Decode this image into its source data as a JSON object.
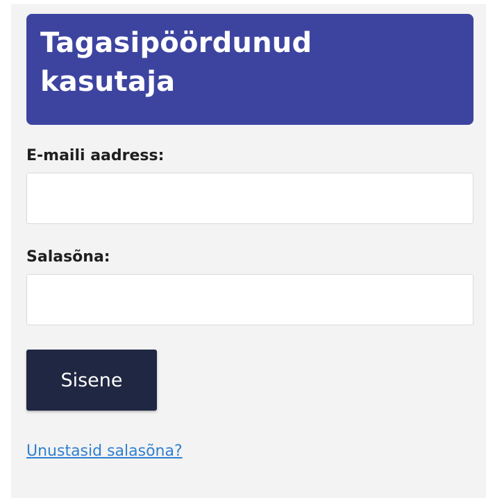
{
  "login": {
    "title_line1": "Tagasipöördunud",
    "title_line2": "kasutaja",
    "email_label": "E-maili aadress:",
    "email_value": "",
    "password_label": "Salasõna:",
    "password_value": "",
    "submit_label": "Sisene",
    "forgot_link": "Unustasid salasõna?"
  },
  "colors": {
    "header_bg": "#3d44a0",
    "button_bg": "#1f2742",
    "link": "#2f7fd0",
    "panel_bg": "#f3f3f3"
  }
}
